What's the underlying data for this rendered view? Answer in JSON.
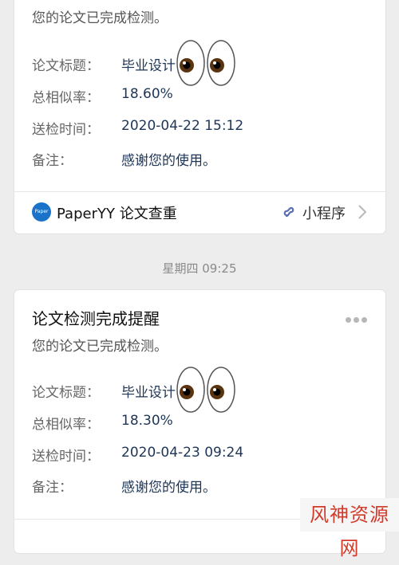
{
  "card1": {
    "subtitle": "您的论文已完成检测。",
    "rows": [
      {
        "label": "论文标题：",
        "value": "毕业设计"
      },
      {
        "label": "总相似率：",
        "value": "18.60%"
      },
      {
        "label": "送检时间：",
        "value": "2020-04-22 15:12"
      },
      {
        "label": "备注：",
        "value": "感谢您的使用。"
      }
    ],
    "footer": {
      "logo_text": "Paper",
      "brand": "PaperYY 论文查重",
      "mini_program_label": "小程序"
    }
  },
  "timestamp": "星期四 09:25",
  "card2": {
    "title": "论文检测完成提醒",
    "subtitle": "您的论文已完成检测。",
    "rows": [
      {
        "label": "论文标题：",
        "value": "毕业设计"
      },
      {
        "label": "总相似率：",
        "value": "18.30%"
      },
      {
        "label": "送检时间：",
        "value": "2020-04-23 09:24"
      },
      {
        "label": "备注：",
        "value": "感谢您的使用。"
      }
    ]
  },
  "watermark": "风神资源网",
  "colors": {
    "background": "#ededed",
    "card": "#ffffff",
    "value_text": "#1d3557",
    "brand_logo": "#1a73c9",
    "watermark": "#d23b2a"
  },
  "icons": [
    "paperyy-logo-icon",
    "mini-program-icon",
    "chevron-right-icon",
    "more-dots-icon",
    "eyes-emoji-icon"
  ]
}
